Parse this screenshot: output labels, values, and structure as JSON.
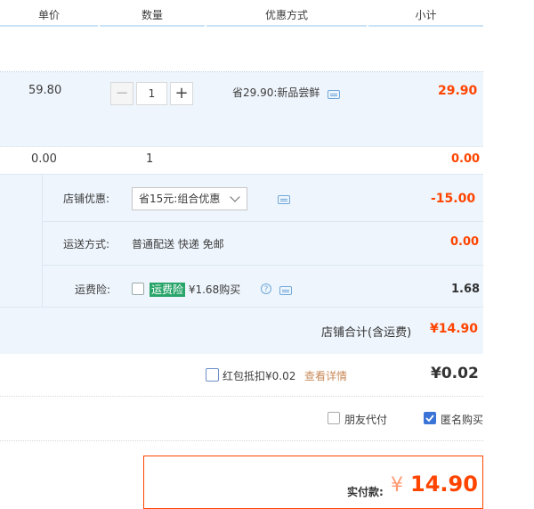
{
  "columns": [
    "单价",
    "数量",
    "优惠方式",
    "小计"
  ],
  "item1": {
    "unit_price": "59.80",
    "quantity": "1",
    "minus": "−",
    "plus": "+",
    "discount": "省29.90:新品尝鲜",
    "subtotal": "29.90"
  },
  "item2": {
    "unit_price": "0.00",
    "quantity": "1",
    "subtotal": "0.00"
  },
  "shop": {
    "discount_label": "店铺优惠:",
    "discount_select": "省15元:组合优惠",
    "discount_amount": "-15.00",
    "shipping_label": "运送方式:",
    "shipping_value": "普通配送 快递 免邮",
    "shipping_amount": "0.00",
    "insurance_label": "运费险:",
    "insurance_tag": "运费险",
    "insurance_text": "¥1.68购买",
    "insurance_amount": "1.68",
    "total_label": "店铺合计(含运费)",
    "total_value": "¥14.90"
  },
  "redpacket": {
    "label": "红包抵扣¥0.02",
    "link": "查看详情",
    "amount": "¥0.02"
  },
  "options": {
    "friend_pay": "朋友代付",
    "anonymous": "匿名购买"
  },
  "pay": {
    "label": "实付款:",
    "currency": "¥",
    "amount": "14.90"
  },
  "colors": {
    "accent": "#ff4400",
    "panel": "#eef5fc",
    "link": "#3c8dcc"
  }
}
